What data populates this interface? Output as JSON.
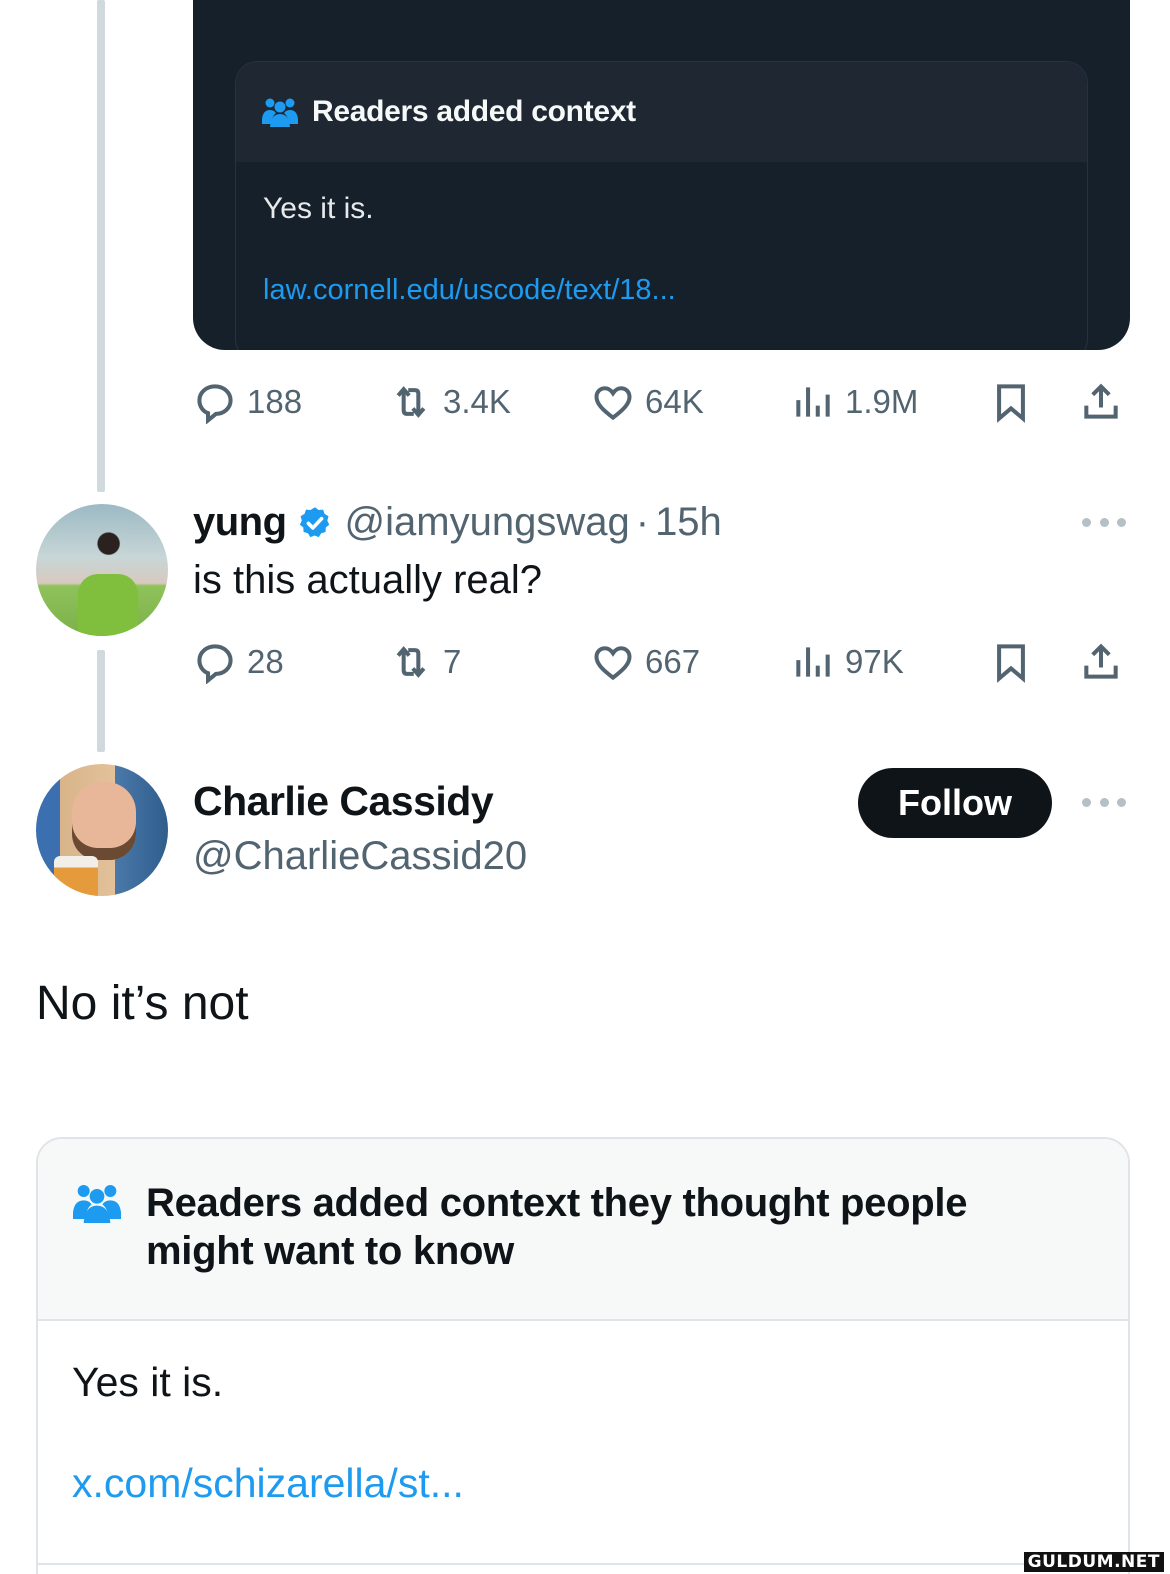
{
  "quoted_card": {
    "note_title": "Readers added context",
    "note_text": "Yes it is.",
    "note_link": "law.cornell.edu/uscode/text/18..."
  },
  "original_actions": {
    "replies": "188",
    "reposts": "3.4K",
    "likes": "64K",
    "views": "1.9M"
  },
  "reply_tweet": {
    "display_name": "yung",
    "verified": true,
    "handle": "@iamyungswag",
    "separator": "·",
    "time": "15h",
    "text": "is this actually real?",
    "actions": {
      "replies": "28",
      "reposts": "7",
      "likes": "667",
      "views": "97K"
    }
  },
  "main_tweet": {
    "display_name": "Charlie Cassidy",
    "handle": "@CharlieCassid20",
    "follow_label": "Follow",
    "text": "No it’s not",
    "community_note": {
      "title": "Readers added context they thought people might want to know",
      "text": "Yes it is.",
      "link": "x.com/schizarella/st..."
    }
  },
  "watermark": "GULDUM.NET",
  "colors": {
    "accent": "#1d9bf0",
    "text_primary": "#0f1419",
    "text_secondary": "#536471",
    "dark_bg": "#15202b",
    "border": "#dfe4e8"
  }
}
